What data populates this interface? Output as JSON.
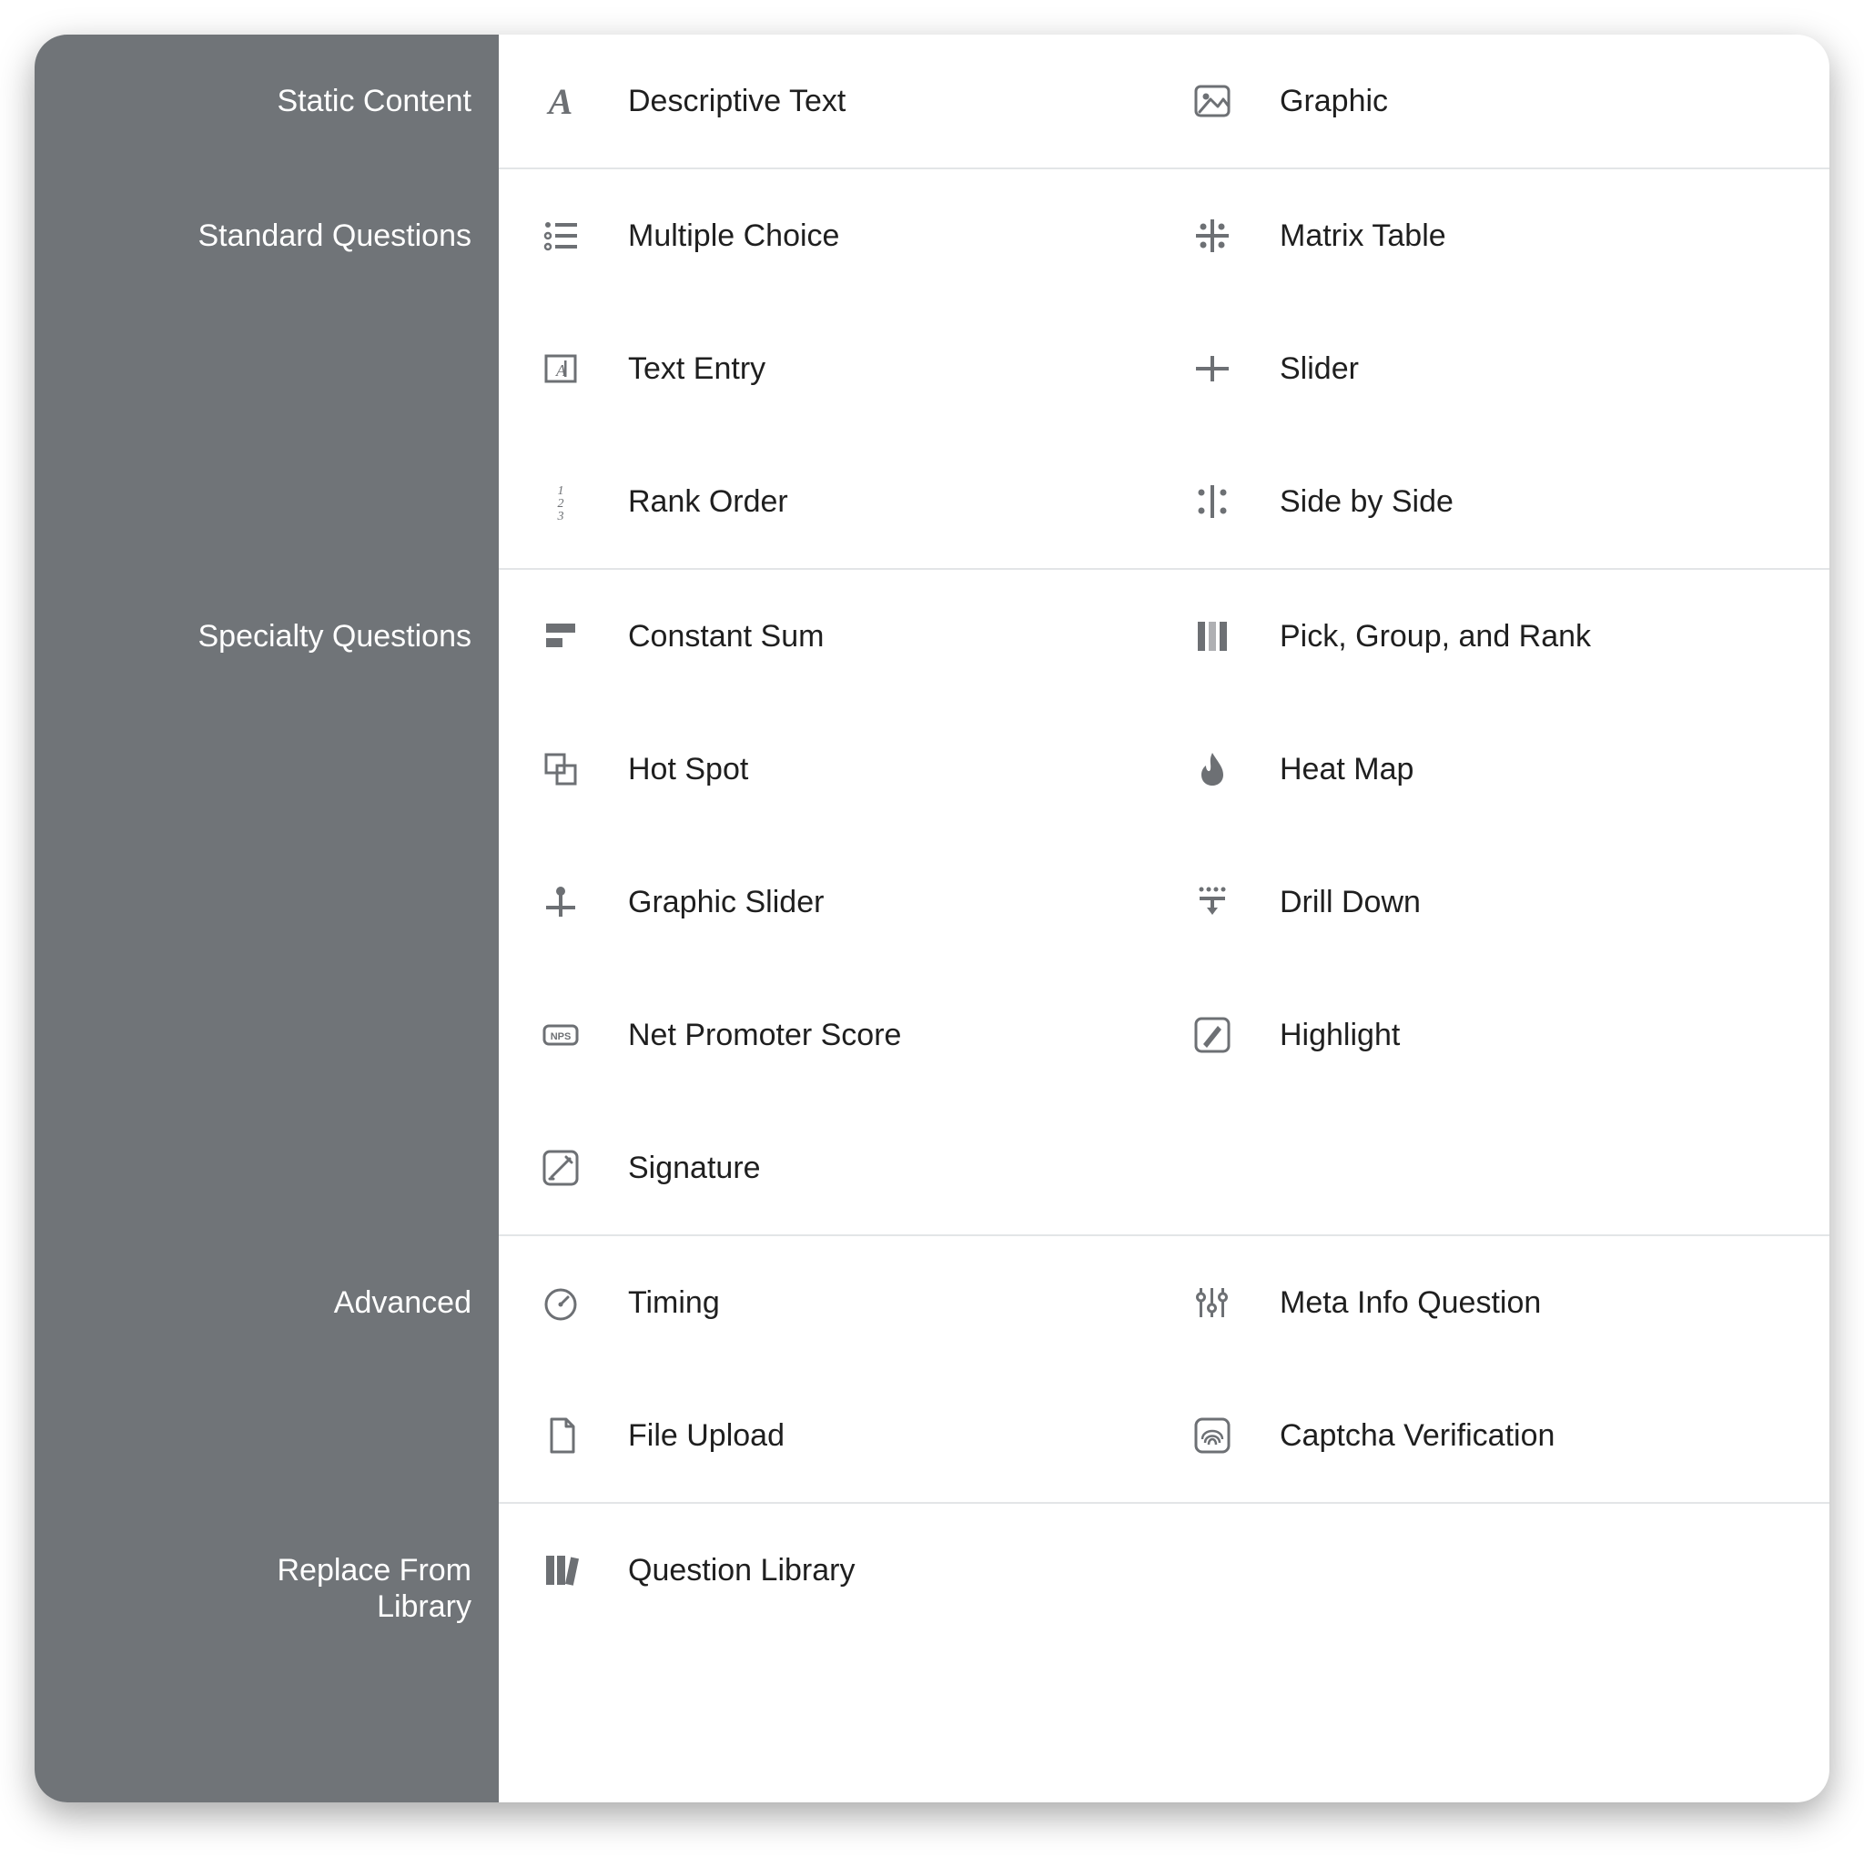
{
  "categories": [
    {
      "key": "static",
      "label": "Static Content"
    },
    {
      "key": "standard",
      "label": "Standard Questions"
    },
    {
      "key": "specialty",
      "label": "Specialty Questions"
    },
    {
      "key": "advanced",
      "label": "Advanced"
    },
    {
      "key": "library",
      "label": "Replace From\nLibrary"
    }
  ],
  "items": {
    "static": [
      {
        "key": "descriptive",
        "label": "Descriptive Text",
        "icon": "letter-a-icon"
      },
      {
        "key": "graphic",
        "label": "Graphic",
        "icon": "image-icon"
      }
    ],
    "standard": [
      {
        "key": "multiple_choice",
        "label": "Multiple Choice",
        "icon": "bullet-list-icon"
      },
      {
        "key": "matrix",
        "label": "Matrix Table",
        "icon": "matrix-icon"
      },
      {
        "key": "text_entry",
        "label": "Text Entry",
        "icon": "text-cursor-icon"
      },
      {
        "key": "slider",
        "label": "Slider",
        "icon": "slider-handle-icon"
      },
      {
        "key": "rank_order",
        "label": "Rank Order",
        "icon": "numbered-list-icon"
      },
      {
        "key": "side_by_side",
        "label": "Side by Side",
        "icon": "side-by-side-icon"
      }
    ],
    "specialty": [
      {
        "key": "constant_sum",
        "label": "Constant Sum",
        "icon": "bars-horizontal-icon"
      },
      {
        "key": "pick_group_rank",
        "label": "Pick, Group, and Rank",
        "icon": "columns-icon"
      },
      {
        "key": "hot_spot",
        "label": "Hot Spot",
        "icon": "overlap-squares-icon"
      },
      {
        "key": "heat_map",
        "label": "Heat Map",
        "icon": "flame-icon"
      },
      {
        "key": "graphic_slider",
        "label": "Graphic Slider",
        "icon": "graphic-slider-icon"
      },
      {
        "key": "drill_down",
        "label": "Drill Down",
        "icon": "drill-down-icon"
      },
      {
        "key": "nps",
        "label": "Net Promoter Score",
        "icon": "nps-badge-icon"
      },
      {
        "key": "highlight",
        "label": "Highlight",
        "icon": "highlight-pen-icon"
      },
      {
        "key": "signature",
        "label": "Signature",
        "icon": "signature-icon"
      }
    ],
    "advanced": [
      {
        "key": "timing",
        "label": "Timing",
        "icon": "stopwatch-icon"
      },
      {
        "key": "meta_info",
        "label": "Meta Info Question",
        "icon": "sliders-vertical-icon"
      },
      {
        "key": "file_upload",
        "label": "File Upload",
        "icon": "file-icon"
      },
      {
        "key": "captcha",
        "label": "Captcha Verification",
        "icon": "fingerprint-icon"
      }
    ],
    "library": [
      {
        "key": "question_library",
        "label": "Question Library",
        "icon": "books-icon"
      }
    ]
  }
}
